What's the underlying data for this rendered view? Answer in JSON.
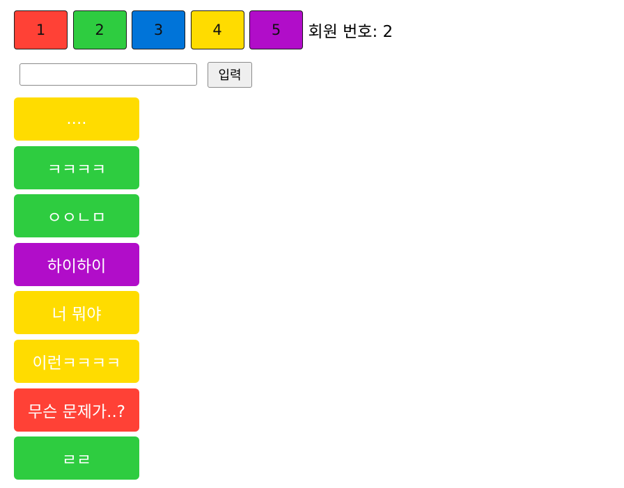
{
  "members": {
    "buttons": [
      {
        "label": "1",
        "color": "#FF4136"
      },
      {
        "label": "2",
        "color": "#2ECC40"
      },
      {
        "label": "3",
        "color": "#0074D9"
      },
      {
        "label": "4",
        "color": "#FFDC00"
      },
      {
        "label": "5",
        "color": "#B10DC9"
      }
    ],
    "label_prefix": "회원 번호:",
    "current_number": "2"
  },
  "input": {
    "value": "",
    "placeholder": "",
    "submit_label": "입력"
  },
  "messages": [
    {
      "text": "....",
      "color": "#FFDC00"
    },
    {
      "text": "ㅋㅋㅋㅋ",
      "color": "#2ECC40"
    },
    {
      "text": "ㅇㅇㄴㅁ",
      "color": "#2ECC40"
    },
    {
      "text": "하이하이",
      "color": "#B10DC9"
    },
    {
      "text": "너 뭐야",
      "color": "#FFDC00"
    },
    {
      "text": "이런ㅋㅋㅋㅋ",
      "color": "#FFDC00"
    },
    {
      "text": "무슨 문제가..?",
      "color": "#FF4136"
    },
    {
      "text": "ㄹㄹ",
      "color": "#2ECC40"
    }
  ]
}
